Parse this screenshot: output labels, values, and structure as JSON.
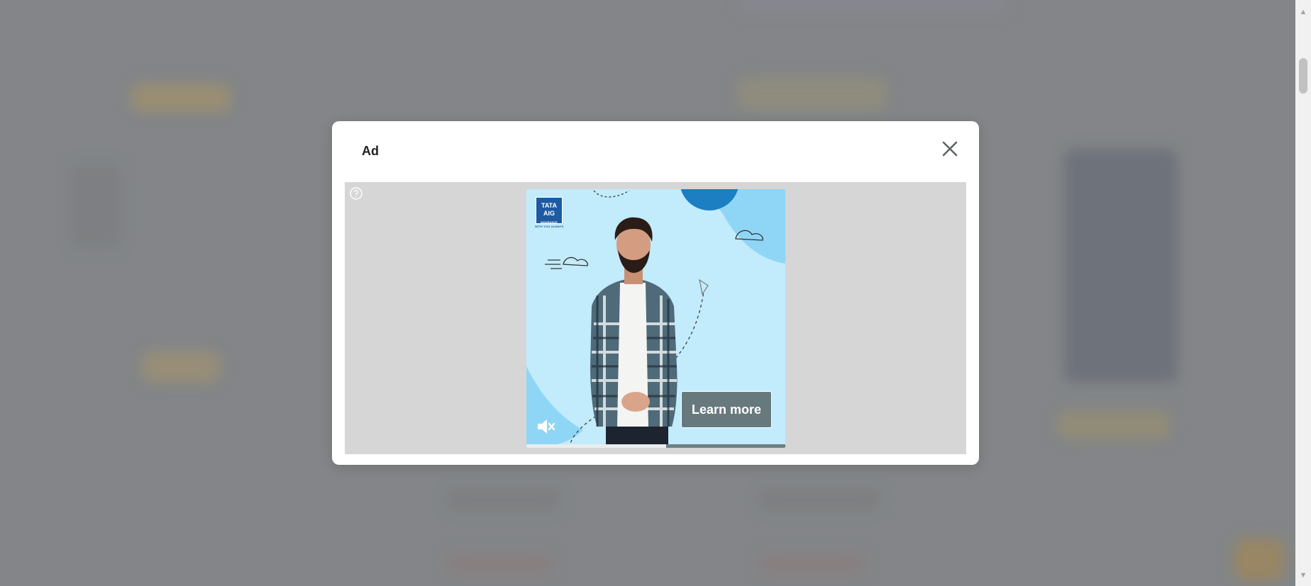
{
  "modal": {
    "title": "Ad",
    "close_icon": "close-icon"
  },
  "ad": {
    "help_icon": "question-circle-icon",
    "brand_logo_text": "TATA AIG",
    "brand_logo_subtext": "INSURANCE",
    "brand_tagline": "WITH YOU ALWAYS",
    "cta_label": "Learn more",
    "mute_icon": "speaker-muted-icon",
    "video_progress": 0.54,
    "colors": {
      "creative_bg": "#c2ebfb",
      "accent_blue": "#1b7fc1",
      "cta_bg": "#68797e"
    }
  },
  "scrollbar": {
    "up_icon": "scroll-up-arrow-icon",
    "down_icon": "scroll-down-arrow-icon"
  }
}
